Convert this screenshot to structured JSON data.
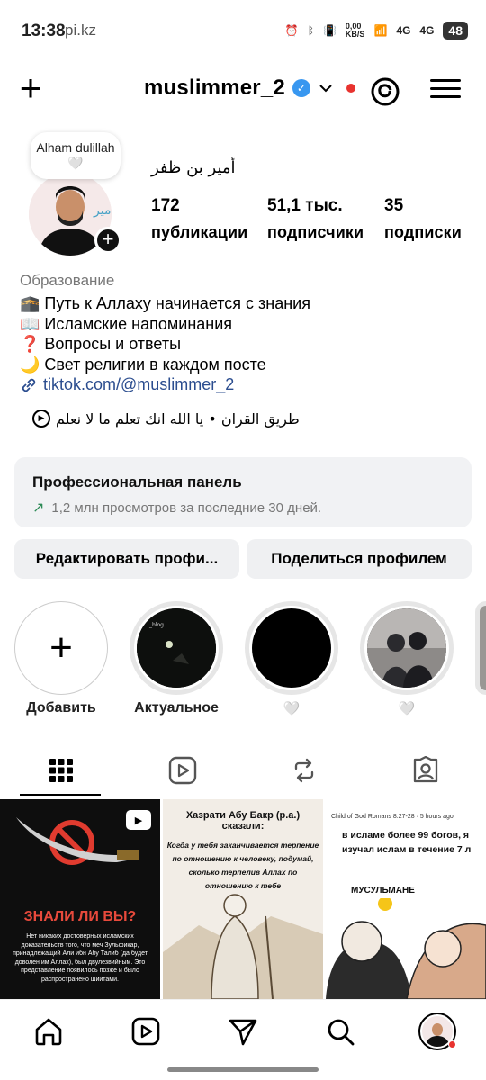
{
  "status_bar": {
    "time": "13:38",
    "watermark": "pi.kz",
    "net_speed": "0,00\nKB/S",
    "signal1": "4G",
    "signal2": "4G",
    "battery": "48"
  },
  "header": {
    "username": "muslimmer_2"
  },
  "profile": {
    "note": "Alham dulillah 🤍",
    "full_name": "أمير بن ظفر",
    "stats": [
      {
        "value": "172",
        "label": "публикации"
      },
      {
        "value": "51,1 тыс.",
        "label": "подписчики"
      },
      {
        "value": "35",
        "label": "подписки"
      }
    ],
    "category": "Образование",
    "bio_lines": [
      "🕋 Путь к Аллаху начинается с знания",
      "📖 Исламские напоминания",
      "❓ Вопросы и ответы",
      "🌙 Свет религии в каждом посте"
    ],
    "link": "tiktok.com/@muslimmer_2",
    "arabic_line": "طريق القران • يا الله انك تعلم ما لا نعلم"
  },
  "dashboard": {
    "title": "Профессиональная панель",
    "subtitle": "1,2 млн просмотров за последние 30 дней."
  },
  "buttons": {
    "edit": "Редактировать профи...",
    "share": "Поделиться профилем"
  },
  "highlights": [
    {
      "label": "Добавить"
    },
    {
      "label": "Актуальное"
    },
    {
      "label": "🤍"
    },
    {
      "label": "🤍"
    }
  ],
  "grid": [
    {
      "title": "ЗНАЛИ ЛИ ВЫ?",
      "text": "Нет никаких достоверных исламских доказательств того, что меч Зульфикар, принадлежащий Али ибн Абу Талиб (да будет доволен им Аллах), был двулезвийным. Это представление появилось позже и было распространено шиитами."
    },
    {
      "title": "Хазрати Абу Бакр (р.а.) сказали:",
      "text": "Когда у тебя заканчивается терпение по отношению к человеку, подумай, сколько терпелив Аллах по отношению к тебе"
    },
    {
      "meta": "Child of God Romans 8:27-28 · 5 hours ago",
      "text": "в исламе более 99 богов, я изучал ислам в течение 7 л",
      "meme": "МУСУЛЬМАНЕ"
    }
  ],
  "colors": {
    "verified": "#3897f0",
    "link": "#2b4d8f",
    "notify": "#e8332f"
  }
}
